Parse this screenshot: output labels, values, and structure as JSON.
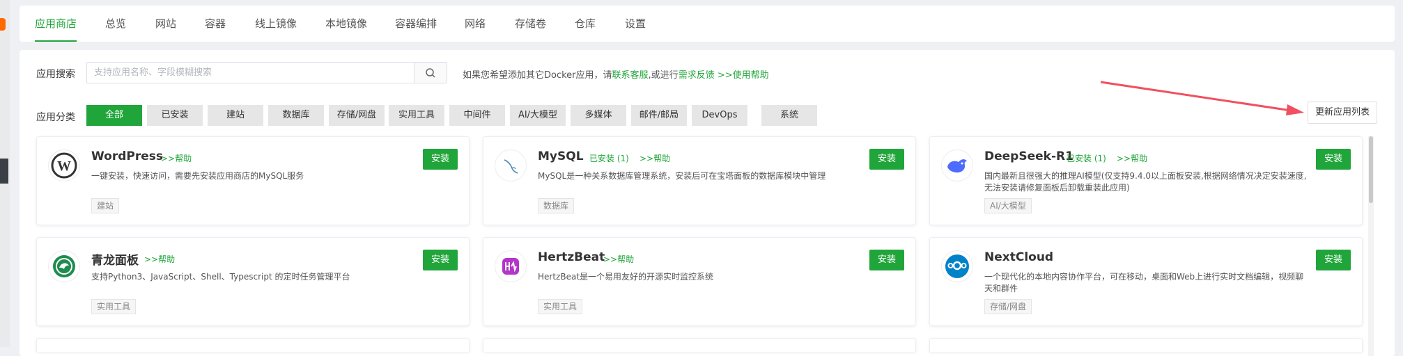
{
  "tabs": [
    {
      "label": "应用商店",
      "active": true
    },
    {
      "label": "总览"
    },
    {
      "label": "网站"
    },
    {
      "label": "容器"
    },
    {
      "label": "线上镜像"
    },
    {
      "label": "本地镜像"
    },
    {
      "label": "容器编排"
    },
    {
      "label": "网络"
    },
    {
      "label": "存储卷"
    },
    {
      "label": "仓库"
    },
    {
      "label": "设置"
    }
  ],
  "search": {
    "label": "应用搜索",
    "placeholder": "支持应用名称、字段模糊搜索",
    "value": ""
  },
  "hint": {
    "prefix": "如果您希望添加其它Docker应用，请",
    "link1": "联系客服",
    "middle": ",或进行",
    "link2": "需求反馈",
    "link3": ">>使用帮助"
  },
  "categories": {
    "label": "应用分类",
    "items": [
      "全部",
      "已安装",
      "建站",
      "数据库",
      "存储/网盘",
      "实用工具",
      "中间件",
      "AI/大模型",
      "多媒体",
      "邮件/邮局",
      "DevOps",
      "系统"
    ],
    "active": "全部"
  },
  "refresh_label": "更新应用列表",
  "install_label": "安装",
  "apps": [
    {
      "name": "WordPress",
      "status": "",
      "help": ">>帮助",
      "desc": "一键安装，快速访问，需要先安装应用商店的MySQL服务",
      "tag": "建站",
      "icon": "wordpress-icon"
    },
    {
      "name": "MySQL",
      "status": "已安装 (1)",
      "help": ">>帮助",
      "desc": "MySQL是一种关系数据库管理系统，安装后可在宝塔面板的数据库模块中管理",
      "tag": "数据库",
      "icon": "mysql-icon"
    },
    {
      "name": "DeepSeek-R1",
      "status": "已安装 (1)",
      "help": ">>帮助",
      "desc": "国内最新且很强大的推理AI模型(仅支持9.4.0以上面板安装,根据网络情况决定安装速度,无法安装请修复面板后卸载重装此应用)",
      "tag": "AI/大模型",
      "icon": "deepseek-icon"
    },
    {
      "name": "青龙面板",
      "status": "",
      "help": ">>帮助",
      "desc": "支持Python3、JavaScript、Shell、Typescript 的定时任务管理平台",
      "tag": "实用工具",
      "icon": "qinglong-icon"
    },
    {
      "name": "HertzBeat",
      "status": "",
      "help": ">>帮助",
      "desc": "HertzBeat是一个易用友好的开源实时监控系统",
      "tag": "实用工具",
      "icon": "hertzbeat-icon"
    },
    {
      "name": "NextCloud",
      "status": "",
      "help": "",
      "desc": "一个现代化的本地内容协作平台，可在移动，桌面和Web上进行实时文档编辑，视频聊天和群件",
      "tag": "存储/网盘",
      "icon": "nextcloud-icon"
    }
  ],
  "colors": {
    "accent": "#20a53a",
    "annotation_arrow": "#f0505f"
  }
}
